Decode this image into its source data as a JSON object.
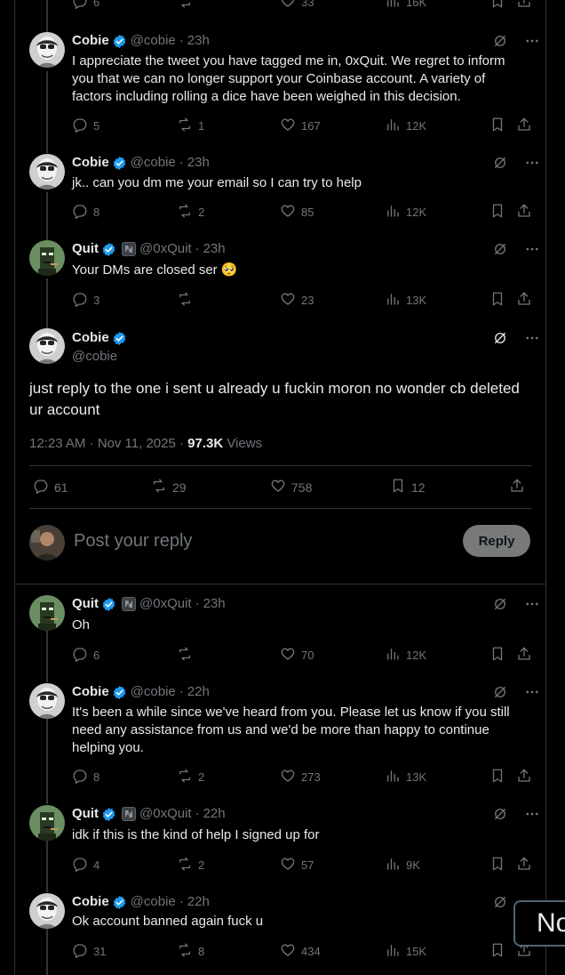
{
  "top_row": {
    "replies": "6",
    "likes": "33",
    "views": "16K"
  },
  "tweets": [
    {
      "name": "Cobie",
      "handle": "@cobie",
      "time": "23h",
      "text": "I appreciate the tweet you have tagged me in, 0xQuit. We regret to inform you that we can no longer support your Coinbase account. A variety of factors including rolling a dice have been weighed in this decision.",
      "replies": "5",
      "reposts": "1",
      "likes": "167",
      "views": "12K"
    },
    {
      "name": "Cobie",
      "handle": "@cobie",
      "time": "23h",
      "text": "jk.. can you dm me your email so I can try to help",
      "replies": "8",
      "reposts": "2",
      "likes": "85",
      "views": "12K"
    },
    {
      "name": "Quit",
      "handle": "@0xQuit",
      "time": "23h",
      "text": "Your DMs are closed ser 🥺",
      "replies": "3",
      "reposts": "",
      "likes": "23",
      "views": "13K"
    }
  ],
  "main_tweet": {
    "name": "Cobie",
    "handle": "@cobie",
    "text": "just reply to the one i sent u already u fuckin moron no wonder cb deleted ur account",
    "timestamp": "12:23 AM · Nov 11, 2025 · ",
    "views_count": "97.3K",
    "views_label": "Views",
    "replies": "61",
    "reposts": "29",
    "likes": "758",
    "bookmarks": "12"
  },
  "composer": {
    "placeholder": "Post your reply",
    "button_label": "Reply"
  },
  "replies": [
    {
      "name": "Quit",
      "handle": "@0xQuit",
      "time": "23h",
      "text": "Oh",
      "replies": "6",
      "reposts": "",
      "likes": "70",
      "views": "12K"
    },
    {
      "name": "Cobie",
      "handle": "@cobie",
      "time": "22h",
      "text": "It's been a while since we've heard from you. Please let us know if you still need any assistance from us and we'd be more than happy to continue helping you.",
      "replies": "8",
      "reposts": "2",
      "likes": "273",
      "views": "13K"
    },
    {
      "name": "Quit",
      "handle": "@0xQuit",
      "time": "22h",
      "text": "idk if this is the kind of help I signed up for",
      "replies": "4",
      "reposts": "2",
      "likes": "57",
      "views": "9K"
    },
    {
      "name": "Cobie",
      "handle": "@cobie",
      "time": "22h",
      "text": "Ok account banned again fuck u",
      "replies": "31",
      "reposts": "8",
      "likes": "434",
      "views": "15K"
    }
  ],
  "toast": {
    "text": "No"
  },
  "colors": {
    "background": "#000000",
    "text": "#e7e9ea",
    "muted": "#71767b",
    "verified": "#1d9bf0",
    "divider": "#2f3336"
  }
}
